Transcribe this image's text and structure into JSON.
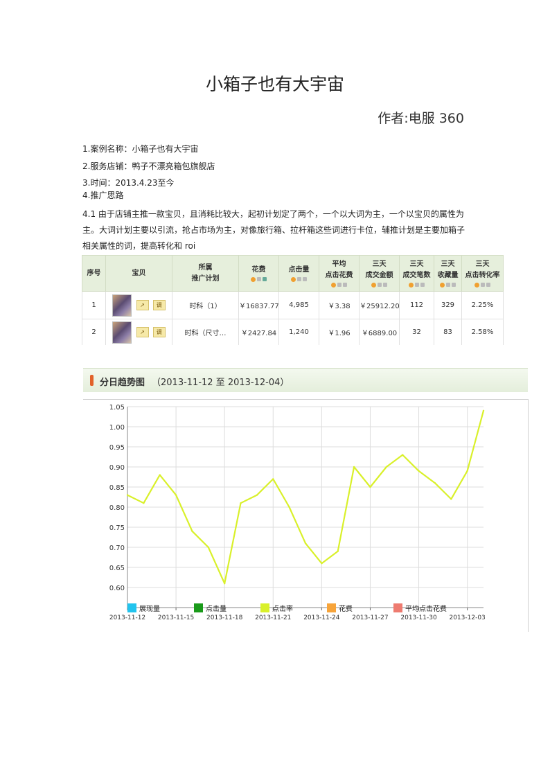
{
  "doc": {
    "title": "小箱子也有大宇宙",
    "author": "作者:电服 360",
    "line1": "1.案例名称：小箱子也有大宇宙",
    "line2": "2.服务店铺：鸭子不漂亮箱包旗舰店",
    "line3": "3.时间：2013.4.23至今",
    "line4": "4.推广思路",
    "paragraph": "4.1 由于店铺主推一款宝贝，且消耗比较大，起初计划定了两个，一个以大词为主，一个以宝贝的属性为主。大词计划主要以引流，抢占市场为主，对像旅行箱、拉杆箱这些词进行卡位，辅推计划是主要加箱子相关属性的词，提高转化和 roi"
  },
  "table": {
    "headers": [
      "序号",
      "宝贝",
      "所属",
      "推广计划",
      "花费",
      "点击量",
      "平均",
      "点击花费",
      "三天",
      "成交金额",
      "三天",
      "成交笔数",
      "三天",
      "收藏量",
      "三天",
      "点击转化率"
    ],
    "btn_label": "调",
    "rows": [
      {
        "no": "1",
        "plan": "时科（1）",
        "cost": "￥16837.77",
        "clicks": "4,985",
        "avg": "￥3.38",
        "amount": "￥25912.20",
        "orders": "112",
        "favs": "329",
        "cvr": "2.25%"
      },
      {
        "no": "2",
        "plan": "时科（尺寸…",
        "cost": "￥2427.84",
        "clicks": "1,240",
        "avg": "￥1.96",
        "amount": "￥6889.00",
        "orders": "32",
        "favs": "83",
        "cvr": "2.58%"
      }
    ]
  },
  "chart_header": {
    "title": "分日趋势图",
    "range": "（2013-11-12 至 2013-12-04）"
  },
  "colors": {
    "line": "#d9f02a",
    "header_bg": "#e6efdc",
    "accent": "#e2622a"
  },
  "chart_data": {
    "type": "line",
    "x": [
      "2013-11-12",
      "2013-11-13",
      "2013-11-14",
      "2013-11-15",
      "2013-11-16",
      "2013-11-17",
      "2013-11-18",
      "2013-11-19",
      "2013-11-20",
      "2013-11-21",
      "2013-11-22",
      "2013-11-23",
      "2013-11-24",
      "2013-11-25",
      "2013-11-26",
      "2013-11-27",
      "2013-11-28",
      "2013-11-29",
      "2013-11-30",
      "2013-12-01",
      "2013-12-02",
      "2013-12-03",
      "2013-12-04"
    ],
    "x_tick_labels": [
      "2013-11-12",
      "2013-11-15",
      "2013-11-18",
      "2013-11-21",
      "2013-11-24",
      "2013-11-27",
      "2013-11-30",
      "2013-12-03"
    ],
    "series": [
      {
        "name": "点击率",
        "values": [
          0.83,
          0.81,
          0.88,
          0.83,
          0.74,
          0.7,
          0.61,
          0.81,
          0.83,
          0.87,
          0.8,
          0.71,
          0.66,
          0.69,
          0.9,
          0.85,
          0.9,
          0.93,
          0.89,
          0.86,
          0.82,
          0.89,
          1.04
        ]
      }
    ],
    "ylim": [
      0.55,
      1.05
    ],
    "y_ticks": [
      "1.05",
      "1.00",
      "0.95",
      "0.90",
      "0.85",
      "0.80",
      "0.75",
      "0.70",
      "0.65",
      "0.60"
    ],
    "legend": [
      {
        "label": "展现量",
        "color": "#22c4ee"
      },
      {
        "label": "点击量",
        "color": "#1a9a1a"
      },
      {
        "label": "点击率",
        "color": "#d9f02a"
      },
      {
        "label": "花费",
        "color": "#f7a43a"
      },
      {
        "label": "平均点击花费",
        "color": "#ee7b70"
      }
    ],
    "legend_position": "bottom",
    "grid": true
  }
}
